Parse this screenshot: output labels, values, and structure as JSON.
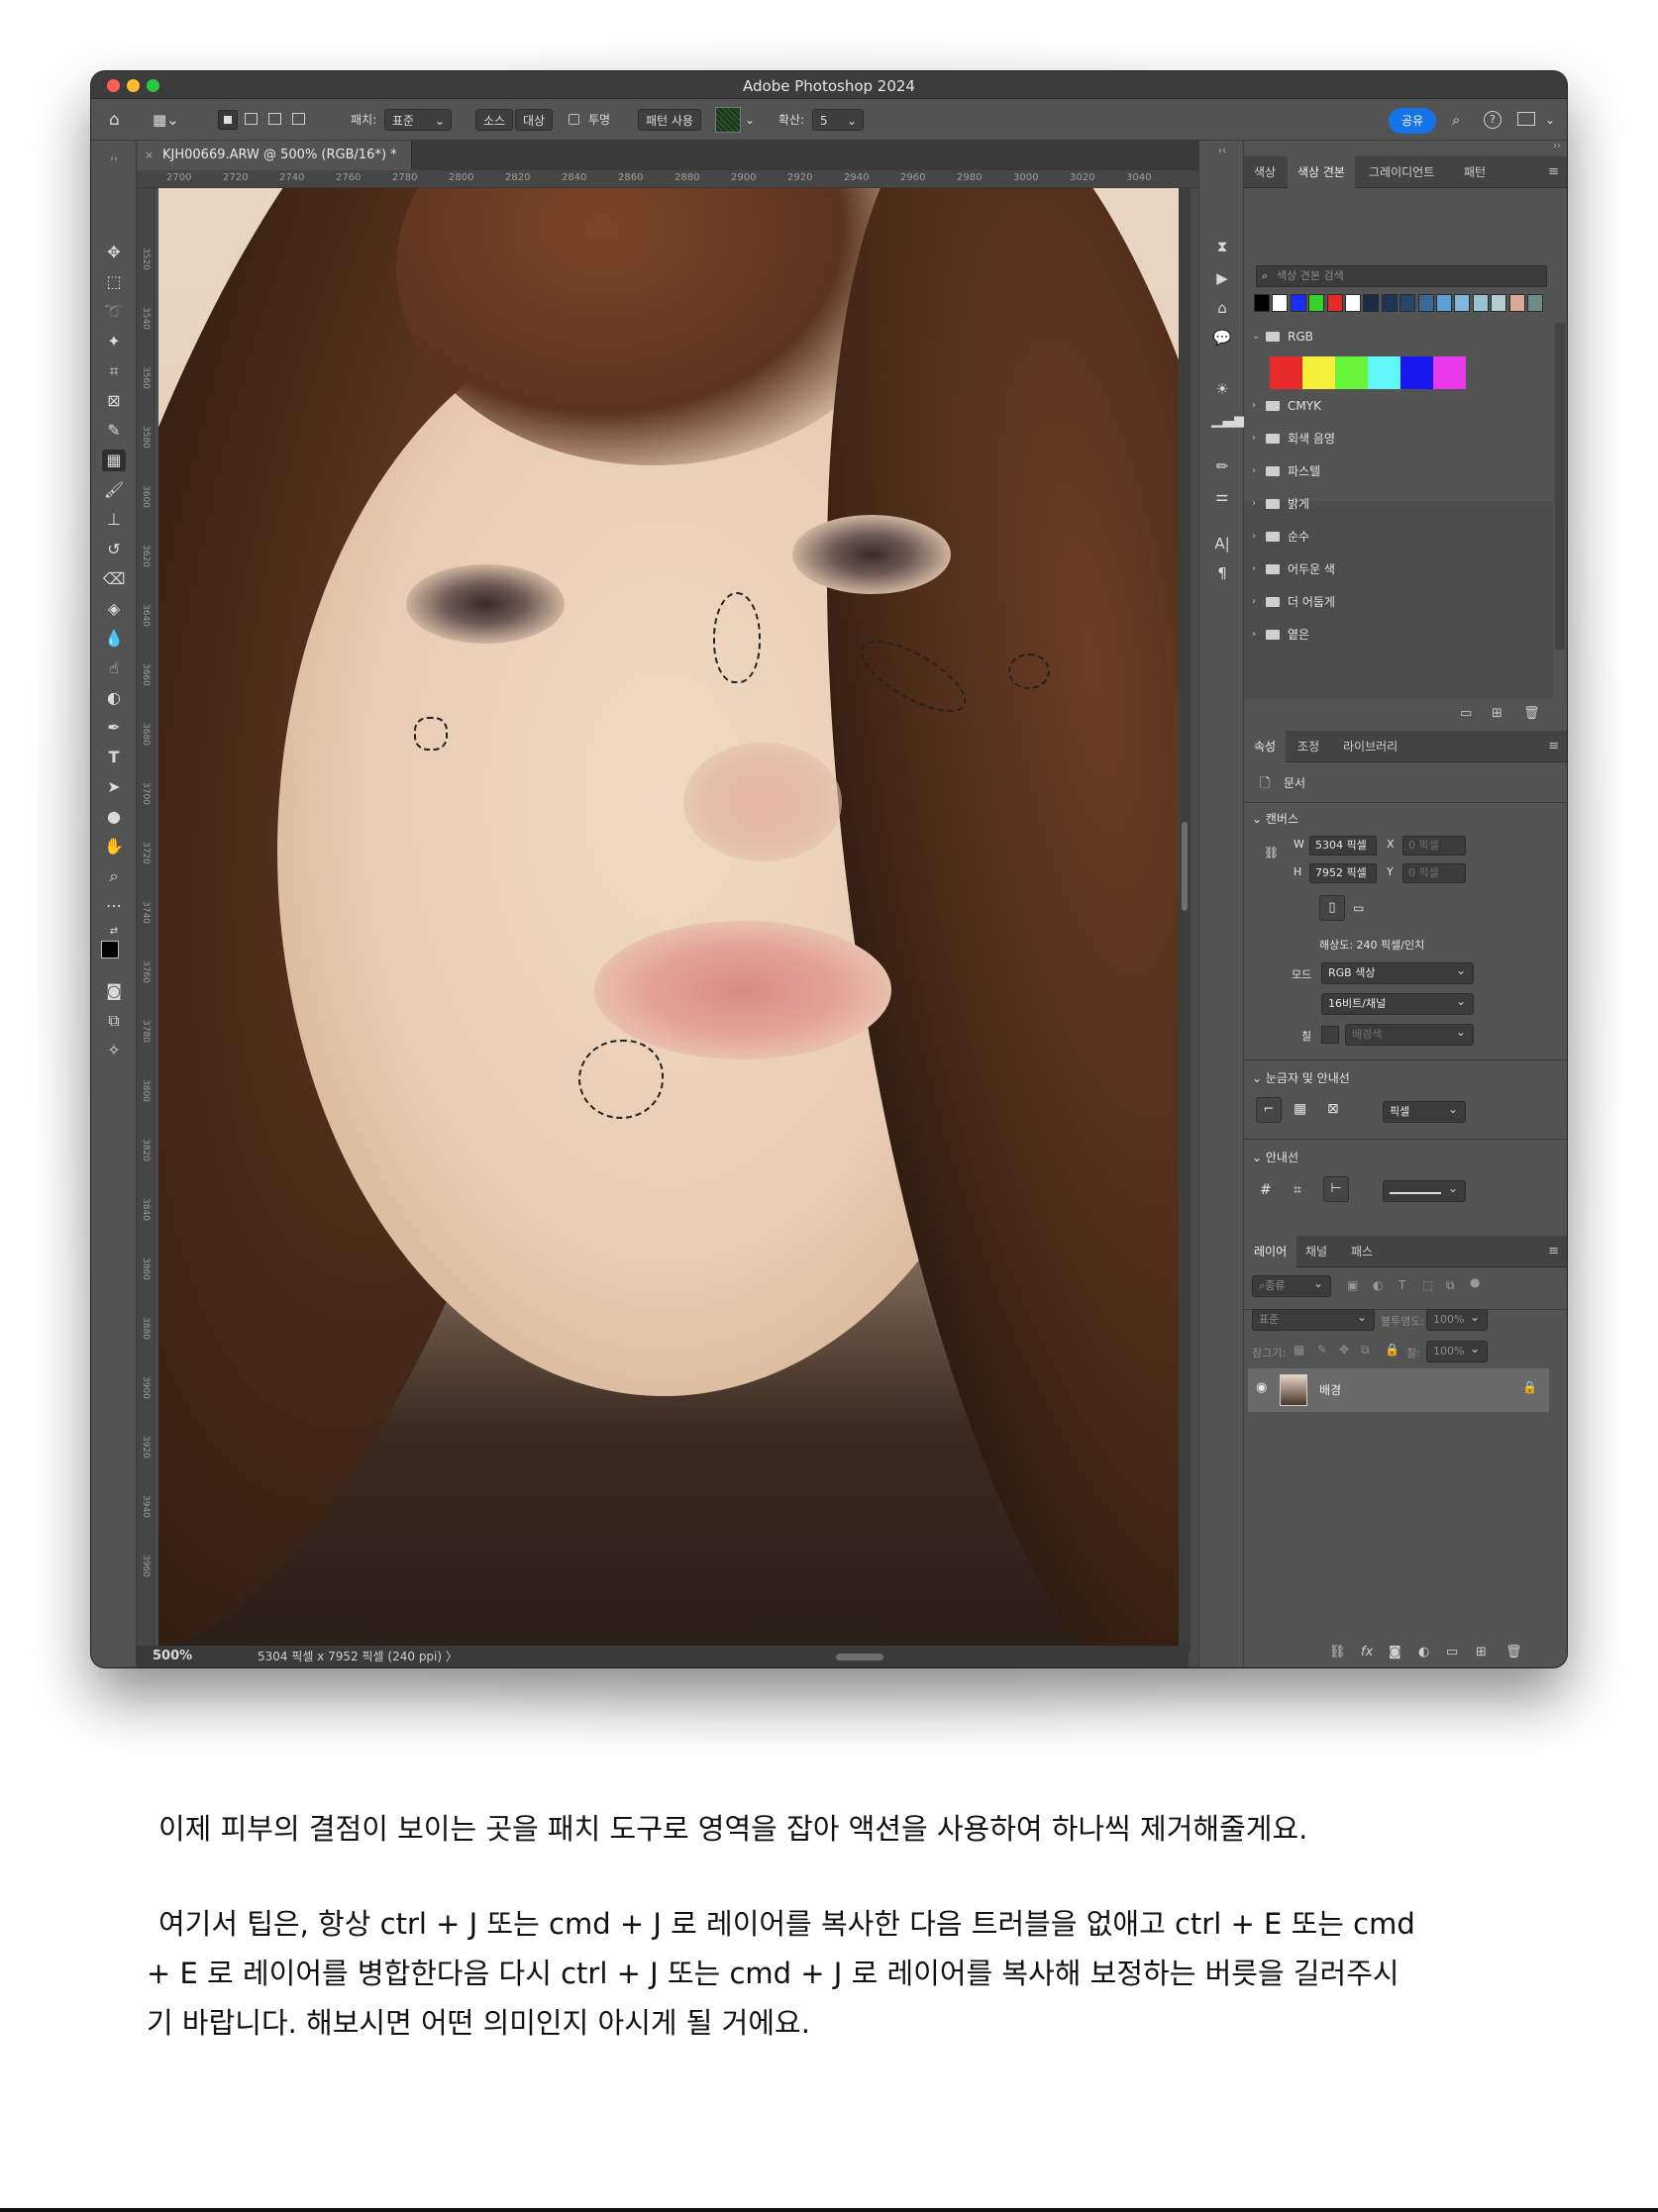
{
  "window": {
    "title": "Adobe Photoshop 2024",
    "doc_tab": "KJH00669.ARW @ 500% (RGB/16*) *"
  },
  "options_bar": {
    "patch_label": "패치:",
    "patch_value": "표준",
    "source_label": "소스",
    "dest_label": "대상",
    "transparent_label": "투명",
    "use_pattern_label": "패턴 사용",
    "diffusion_label": "확산:",
    "diffusion_value": "5",
    "share_label": "공유"
  },
  "ruler": {
    "top_ticks": [
      "2700",
      "2720",
      "2740",
      "2760",
      "2780",
      "2800",
      "2820",
      "2840",
      "2860",
      "2880",
      "2900",
      "2920",
      "2940",
      "2960",
      "2980",
      "3000",
      "3020",
      "3040"
    ],
    "left_ticks": [
      "3520",
      "3540",
      "3560",
      "3580",
      "3600",
      "3620",
      "3640",
      "3660",
      "3680",
      "3700",
      "3720",
      "3740",
      "3760",
      "3780",
      "3800",
      "3820",
      "3840",
      "3860",
      "3880",
      "3900",
      "3920",
      "3940",
      "3960"
    ]
  },
  "status": {
    "zoom": "500%",
    "info": "5304 픽셀 x 7952 픽셀 (240 ppi)",
    "arrow": "〉"
  },
  "swatches_panel": {
    "tabs": [
      "색상",
      "색상 견본",
      "그레이디언트",
      "패턴"
    ],
    "active_tab": "색상 견본",
    "search_placeholder": "색상 견본 검색",
    "top_colors": [
      "#000000",
      "#ffffff",
      "#1b2cff",
      "#3ad12e",
      "#e62a2a",
      "#ffffff",
      "#1c2a44",
      "#203456",
      "#2a4468",
      "#3a6a98",
      "#5aa2d6",
      "#7fb7e0",
      "#9ac2d6",
      "#b4cdd2",
      "#d9aa98",
      "#6e8c8c"
    ],
    "rgb_group": "RGB",
    "rgb_colors": [
      "#e62a2a",
      "#f7f03a",
      "#67f53a",
      "#5ef6f6",
      "#1a18f0",
      "#e83ae8"
    ],
    "groups": [
      "CMYK",
      "회색 음영",
      "파스텔",
      "밝게",
      "순수",
      "어두운 색",
      "더 어둡게",
      "옅은"
    ]
  },
  "properties_panel": {
    "tabs": [
      "속성",
      "조정",
      "라이브러리"
    ],
    "active_tab": "속성",
    "doc_label": "문서",
    "canvas_section": "캔버스",
    "w_label": "W",
    "w_value": "5304 픽셀",
    "h_label": "H",
    "h_value": "7952 픽셀",
    "x_label": "X",
    "x_value": "0 픽셀",
    "y_label": "Y",
    "y_value": "0 픽셀",
    "resolution": "해상도: 240 픽셀/인치",
    "mode_label": "모드",
    "mode_value": "RGB 색상",
    "bit_value": "16비트/채널",
    "fill_label": "칠",
    "fill_value": "배경색",
    "rulers_section": "눈금자 및 안내선",
    "units_value": "픽셀",
    "guides_section": "안내선"
  },
  "layers_panel": {
    "tabs": [
      "레이어",
      "채널",
      "패스"
    ],
    "active_tab": "레이어",
    "filter_value": "종류",
    "blend_value": "표준",
    "opacity_label": "불투명도:",
    "opacity_value": "100%",
    "lock_label": "잠그기:",
    "fill_label": "칠:",
    "fill_value": "100%",
    "layer_name": "배경"
  },
  "caption": {
    "line1": "이제 피부의 결점이 보이는 곳을 패치 도구로 영역을 잡아 액션을 사용하여 하나씩 제거해줄게요.",
    "para2_line1": "여기서 팁은, 항상 ctrl + J 또는 cmd + J 로 레이어를 복사한 다음 트러블을 없애고 ctrl + E 또는 cmd",
    "para2_line2": "+ E 로 레이어를 병합한다음 다시 ctrl + J 또는 cmd + J 로 레이어를 복사해 보정하는 버릇을 길러주시",
    "para2_line3": "기 바랍니다. 해보시면 어떤 의미인지 아시게 될 거에요."
  }
}
